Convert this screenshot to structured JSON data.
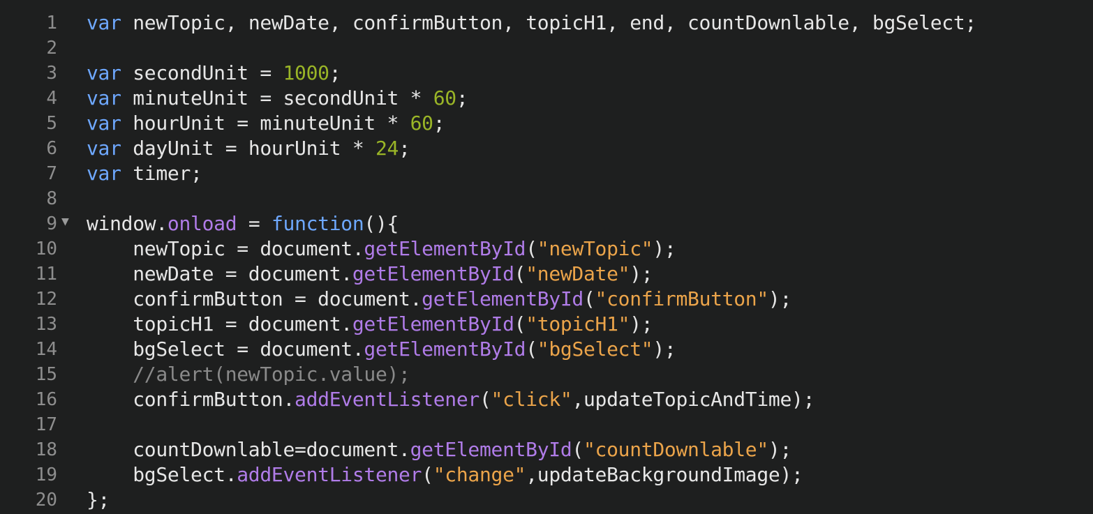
{
  "colors": {
    "background": "#1e1f1f",
    "line_number": "#8e8e8e",
    "keyword": "#6ea8ff",
    "number": "#9ab527",
    "property": "#b07ce8",
    "string": "#eba44a",
    "comment": "#8a8a8a",
    "text": "#e6e6e6"
  },
  "fold_icon": "fold-triangle-down-icon",
  "lines": [
    {
      "num": "1",
      "tokens": [
        {
          "t": "kw",
          "v": "var"
        },
        {
          "t": "plain",
          "v": " newTopic, newDate, confirmButton, topicH1, end, countDownlable, bgSelect;"
        }
      ]
    },
    {
      "num": "2",
      "tokens": []
    },
    {
      "num": "3",
      "tokens": [
        {
          "t": "kw",
          "v": "var"
        },
        {
          "t": "plain",
          "v": " secondUnit = "
        },
        {
          "t": "num",
          "v": "1000"
        },
        {
          "t": "plain",
          "v": ";"
        }
      ]
    },
    {
      "num": "4",
      "tokens": [
        {
          "t": "kw",
          "v": "var"
        },
        {
          "t": "plain",
          "v": " minuteUnit = secondUnit * "
        },
        {
          "t": "num",
          "v": "60"
        },
        {
          "t": "plain",
          "v": ";"
        }
      ]
    },
    {
      "num": "5",
      "tokens": [
        {
          "t": "kw",
          "v": "var"
        },
        {
          "t": "plain",
          "v": " hourUnit = minuteUnit * "
        },
        {
          "t": "num",
          "v": "60"
        },
        {
          "t": "plain",
          "v": ";"
        }
      ]
    },
    {
      "num": "6",
      "tokens": [
        {
          "t": "kw",
          "v": "var"
        },
        {
          "t": "plain",
          "v": " dayUnit = hourUnit * "
        },
        {
          "t": "num",
          "v": "24"
        },
        {
          "t": "plain",
          "v": ";"
        }
      ]
    },
    {
      "num": "7",
      "tokens": [
        {
          "t": "kw",
          "v": "var"
        },
        {
          "t": "plain",
          "v": " timer;"
        }
      ]
    },
    {
      "num": "8",
      "tokens": []
    },
    {
      "num": "9",
      "fold": true,
      "tokens": [
        {
          "t": "plain",
          "v": "window."
        },
        {
          "t": "prop",
          "v": "onload"
        },
        {
          "t": "plain",
          "v": " = "
        },
        {
          "t": "kw",
          "v": "function"
        },
        {
          "t": "plain",
          "v": "(){"
        }
      ]
    },
    {
      "num": "10",
      "tokens": [
        {
          "t": "plain",
          "v": "    newTopic = document."
        },
        {
          "t": "prop",
          "v": "getElementById"
        },
        {
          "t": "plain",
          "v": "("
        },
        {
          "t": "str",
          "v": "\"newTopic\""
        },
        {
          "t": "plain",
          "v": ");"
        }
      ]
    },
    {
      "num": "11",
      "tokens": [
        {
          "t": "plain",
          "v": "    newDate = document."
        },
        {
          "t": "prop",
          "v": "getElementById"
        },
        {
          "t": "plain",
          "v": "("
        },
        {
          "t": "str",
          "v": "\"newDate\""
        },
        {
          "t": "plain",
          "v": ");"
        }
      ]
    },
    {
      "num": "12",
      "tokens": [
        {
          "t": "plain",
          "v": "    confirmButton = document."
        },
        {
          "t": "prop",
          "v": "getElementById"
        },
        {
          "t": "plain",
          "v": "("
        },
        {
          "t": "str",
          "v": "\"confirmButton\""
        },
        {
          "t": "plain",
          "v": ");"
        }
      ]
    },
    {
      "num": "13",
      "tokens": [
        {
          "t": "plain",
          "v": "    topicH1 = document."
        },
        {
          "t": "prop",
          "v": "getElementById"
        },
        {
          "t": "plain",
          "v": "("
        },
        {
          "t": "str",
          "v": "\"topicH1\""
        },
        {
          "t": "plain",
          "v": ");"
        }
      ]
    },
    {
      "num": "14",
      "tokens": [
        {
          "t": "plain",
          "v": "    bgSelect = document."
        },
        {
          "t": "prop",
          "v": "getElementById"
        },
        {
          "t": "plain",
          "v": "("
        },
        {
          "t": "str",
          "v": "\"bgSelect\""
        },
        {
          "t": "plain",
          "v": ");"
        }
      ]
    },
    {
      "num": "15",
      "tokens": [
        {
          "t": "plain",
          "v": "    "
        },
        {
          "t": "cmt",
          "v": "//alert(newTopic.value);"
        }
      ]
    },
    {
      "num": "16",
      "tokens": [
        {
          "t": "plain",
          "v": "    confirmButton."
        },
        {
          "t": "prop",
          "v": "addEventListener"
        },
        {
          "t": "plain",
          "v": "("
        },
        {
          "t": "str",
          "v": "\"click\""
        },
        {
          "t": "plain",
          "v": ",updateTopicAndTime);"
        }
      ]
    },
    {
      "num": "17",
      "tokens": []
    },
    {
      "num": "18",
      "tokens": [
        {
          "t": "plain",
          "v": "    countDownlable=document."
        },
        {
          "t": "prop",
          "v": "getElementById"
        },
        {
          "t": "plain",
          "v": "("
        },
        {
          "t": "str",
          "v": "\"countDownlable\""
        },
        {
          "t": "plain",
          "v": ");"
        }
      ]
    },
    {
      "num": "19",
      "tokens": [
        {
          "t": "plain",
          "v": "    bgSelect."
        },
        {
          "t": "prop",
          "v": "addEventListener"
        },
        {
          "t": "plain",
          "v": "("
        },
        {
          "t": "str",
          "v": "\"change\""
        },
        {
          "t": "plain",
          "v": ",updateBackgroundImage);"
        }
      ]
    },
    {
      "num": "20",
      "tokens": [
        {
          "t": "plain",
          "v": "};"
        }
      ]
    }
  ]
}
